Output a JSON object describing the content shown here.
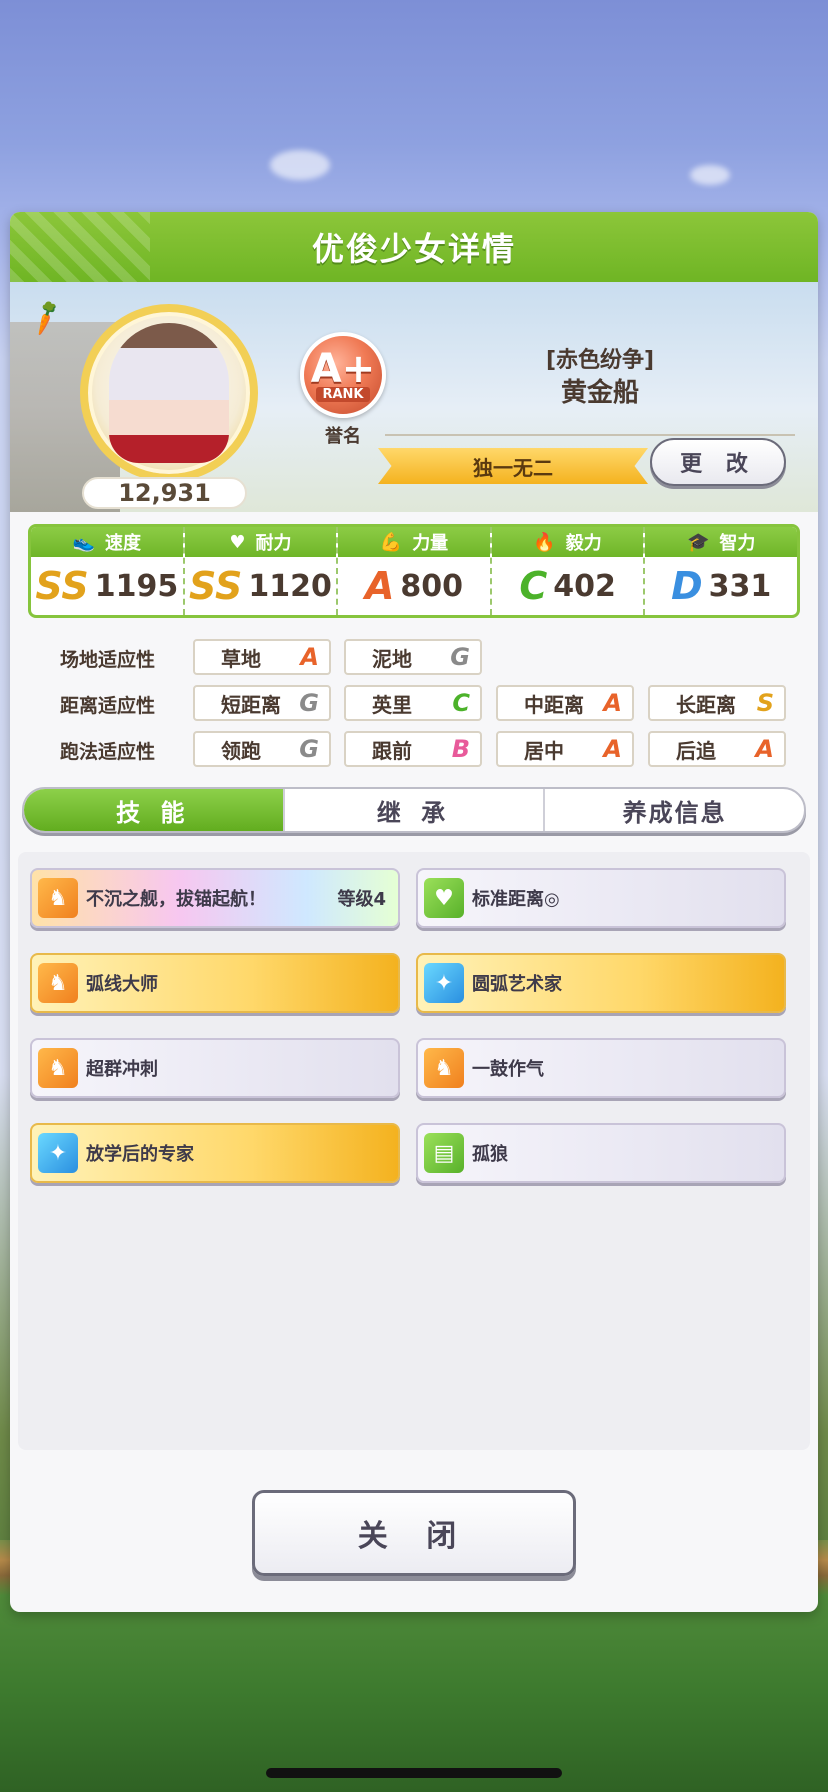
{
  "header": {
    "title": "优俊少女详情"
  },
  "profile": {
    "score": "12,931",
    "rank": {
      "letter": "A+",
      "word": "RANK",
      "caption": "誉名"
    },
    "epithet": "[赤色纷争]",
    "name": "黄金船",
    "title": "独一无二",
    "change_label": "更 改"
  },
  "stats": [
    {
      "label": "速度",
      "icon": "shoe-icon",
      "grade": "SS",
      "value": "1195",
      "color": "#e2a21c"
    },
    {
      "label": "耐力",
      "icon": "heart-icon",
      "grade": "SS",
      "value": "1120",
      "color": "#e2a21c"
    },
    {
      "label": "力量",
      "icon": "arm-icon",
      "grade": "A",
      "value": "800",
      "color": "#e8632a"
    },
    {
      "label": "毅力",
      "icon": "flame-icon",
      "grade": "C",
      "value": "402",
      "color": "#4cb22a"
    },
    {
      "label": "智力",
      "icon": "cap-icon",
      "grade": "D",
      "value": "331",
      "color": "#3a8fe0"
    }
  ],
  "aptitude": {
    "field": {
      "label": "场地适应性",
      "items": [
        {
          "name": "草地",
          "grade": "A"
        },
        {
          "name": "泥地",
          "grade": "G"
        }
      ]
    },
    "distance": {
      "label": "距离适应性",
      "items": [
        {
          "name": "短距离",
          "grade": "G"
        },
        {
          "name": "英里",
          "grade": "C"
        },
        {
          "name": "中距离",
          "grade": "A"
        },
        {
          "name": "长距离",
          "grade": "S"
        }
      ]
    },
    "style": {
      "label": "跑法适应性",
      "items": [
        {
          "name": "领跑",
          "grade": "G"
        },
        {
          "name": "跟前",
          "grade": "B"
        },
        {
          "name": "居中",
          "grade": "A"
        },
        {
          "name": "后追",
          "grade": "A"
        }
      ]
    }
  },
  "tabs": [
    "技 能",
    "继 承",
    "养成信息"
  ],
  "skills": [
    {
      "name": "不沉之舰，拔锚起航！",
      "level": "等级4",
      "style": "rainbow",
      "icon": "horse-icon"
    },
    {
      "name": "标准距离◎",
      "level": "",
      "style": "plain",
      "icon": "heart-icon"
    },
    {
      "name": "弧线大师",
      "level": "",
      "style": "gold",
      "icon": "horse-icon"
    },
    {
      "name": "圆弧艺术家",
      "level": "",
      "style": "gold",
      "icon": "sparkle-icon"
    },
    {
      "name": "超群冲刺",
      "level": "",
      "style": "plain",
      "icon": "horse-icon"
    },
    {
      "name": "一鼓作气",
      "level": "",
      "style": "plain",
      "icon": "horse-icon"
    },
    {
      "name": "放学后的专家",
      "level": "",
      "style": "gold",
      "icon": "sparkle-icon"
    },
    {
      "name": "孤狼",
      "level": "",
      "style": "plain",
      "icon": "book-icon"
    }
  ],
  "close_label": "关 闭"
}
